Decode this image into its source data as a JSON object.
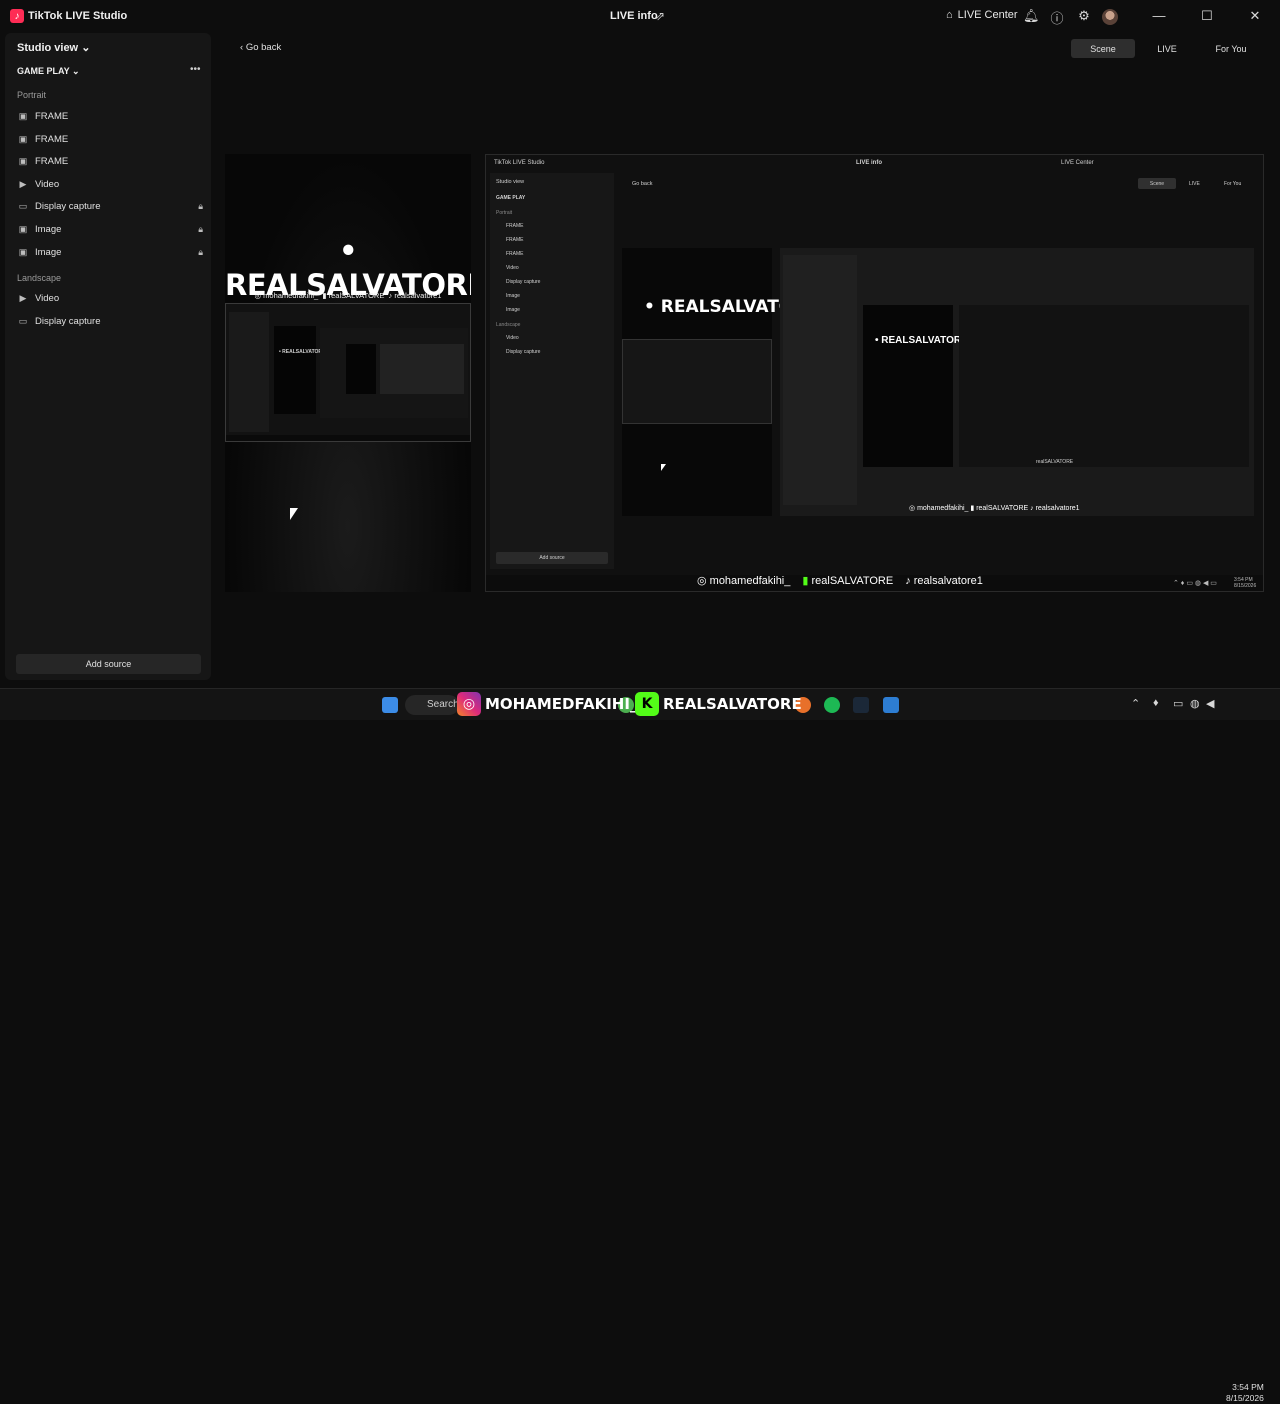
{
  "window": {
    "app_title": "TikTok LIVE Studio",
    "center_title": "LIVE info",
    "live_center_label": "LIVE Center"
  },
  "sidebar": {
    "studio_view_label": "Studio view",
    "scene_name": "GAME PLAY",
    "portrait_label": "Portrait",
    "portrait_items": [
      {
        "label": "FRAME",
        "icon": "image-icon",
        "locked": false
      },
      {
        "label": "FRAME",
        "icon": "image-icon",
        "locked": false
      },
      {
        "label": "FRAME",
        "icon": "image-icon",
        "locked": false
      },
      {
        "label": "Video",
        "icon": "play-icon",
        "locked": false
      },
      {
        "label": "Display capture",
        "icon": "monitor-icon",
        "locked": true
      },
      {
        "label": "Image",
        "icon": "image-icon",
        "locked": true
      },
      {
        "label": "Image",
        "icon": "image-icon",
        "locked": true
      }
    ],
    "landscape_label": "Landscape",
    "landscape_items": [
      {
        "label": "Video",
        "icon": "play-icon"
      },
      {
        "label": "Display capture",
        "icon": "monitor-icon"
      }
    ],
    "add_source_label": "Add source"
  },
  "main": {
    "go_back_label": "Go back",
    "tabs": [
      {
        "label": "Scene",
        "active": true
      },
      {
        "label": "LIVE",
        "active": false
      },
      {
        "label": "For You",
        "active": false
      }
    ]
  },
  "preview": {
    "brand_text": "• REALSALVATORE •",
    "social_handles": [
      "mohamedfakihi_",
      "realSALVATORE",
      "realsalvatore1"
    ],
    "nested_app_title": "TikTok LIVE Studio",
    "nested_center_title": "LIVE info",
    "nested_live_center": "LIVE Center"
  },
  "overlay": {
    "instagram": "mohamedfakihi_",
    "kick": "realSALVATORE",
    "tiktok": "realsalvatore1"
  },
  "taskbar": {
    "search_label": "Search",
    "banner_instagram": "MOHAMEDFAKIHI_",
    "banner_kick": "REALSALVATORE",
    "time": "3:54 PM",
    "date": "8/15/2026"
  },
  "colors": {
    "tiktok_accent": "#fe2c55",
    "kick_green": "#53fc18",
    "instagram_gradient_start": "#f58529",
    "instagram_gradient_end": "#8134af"
  }
}
